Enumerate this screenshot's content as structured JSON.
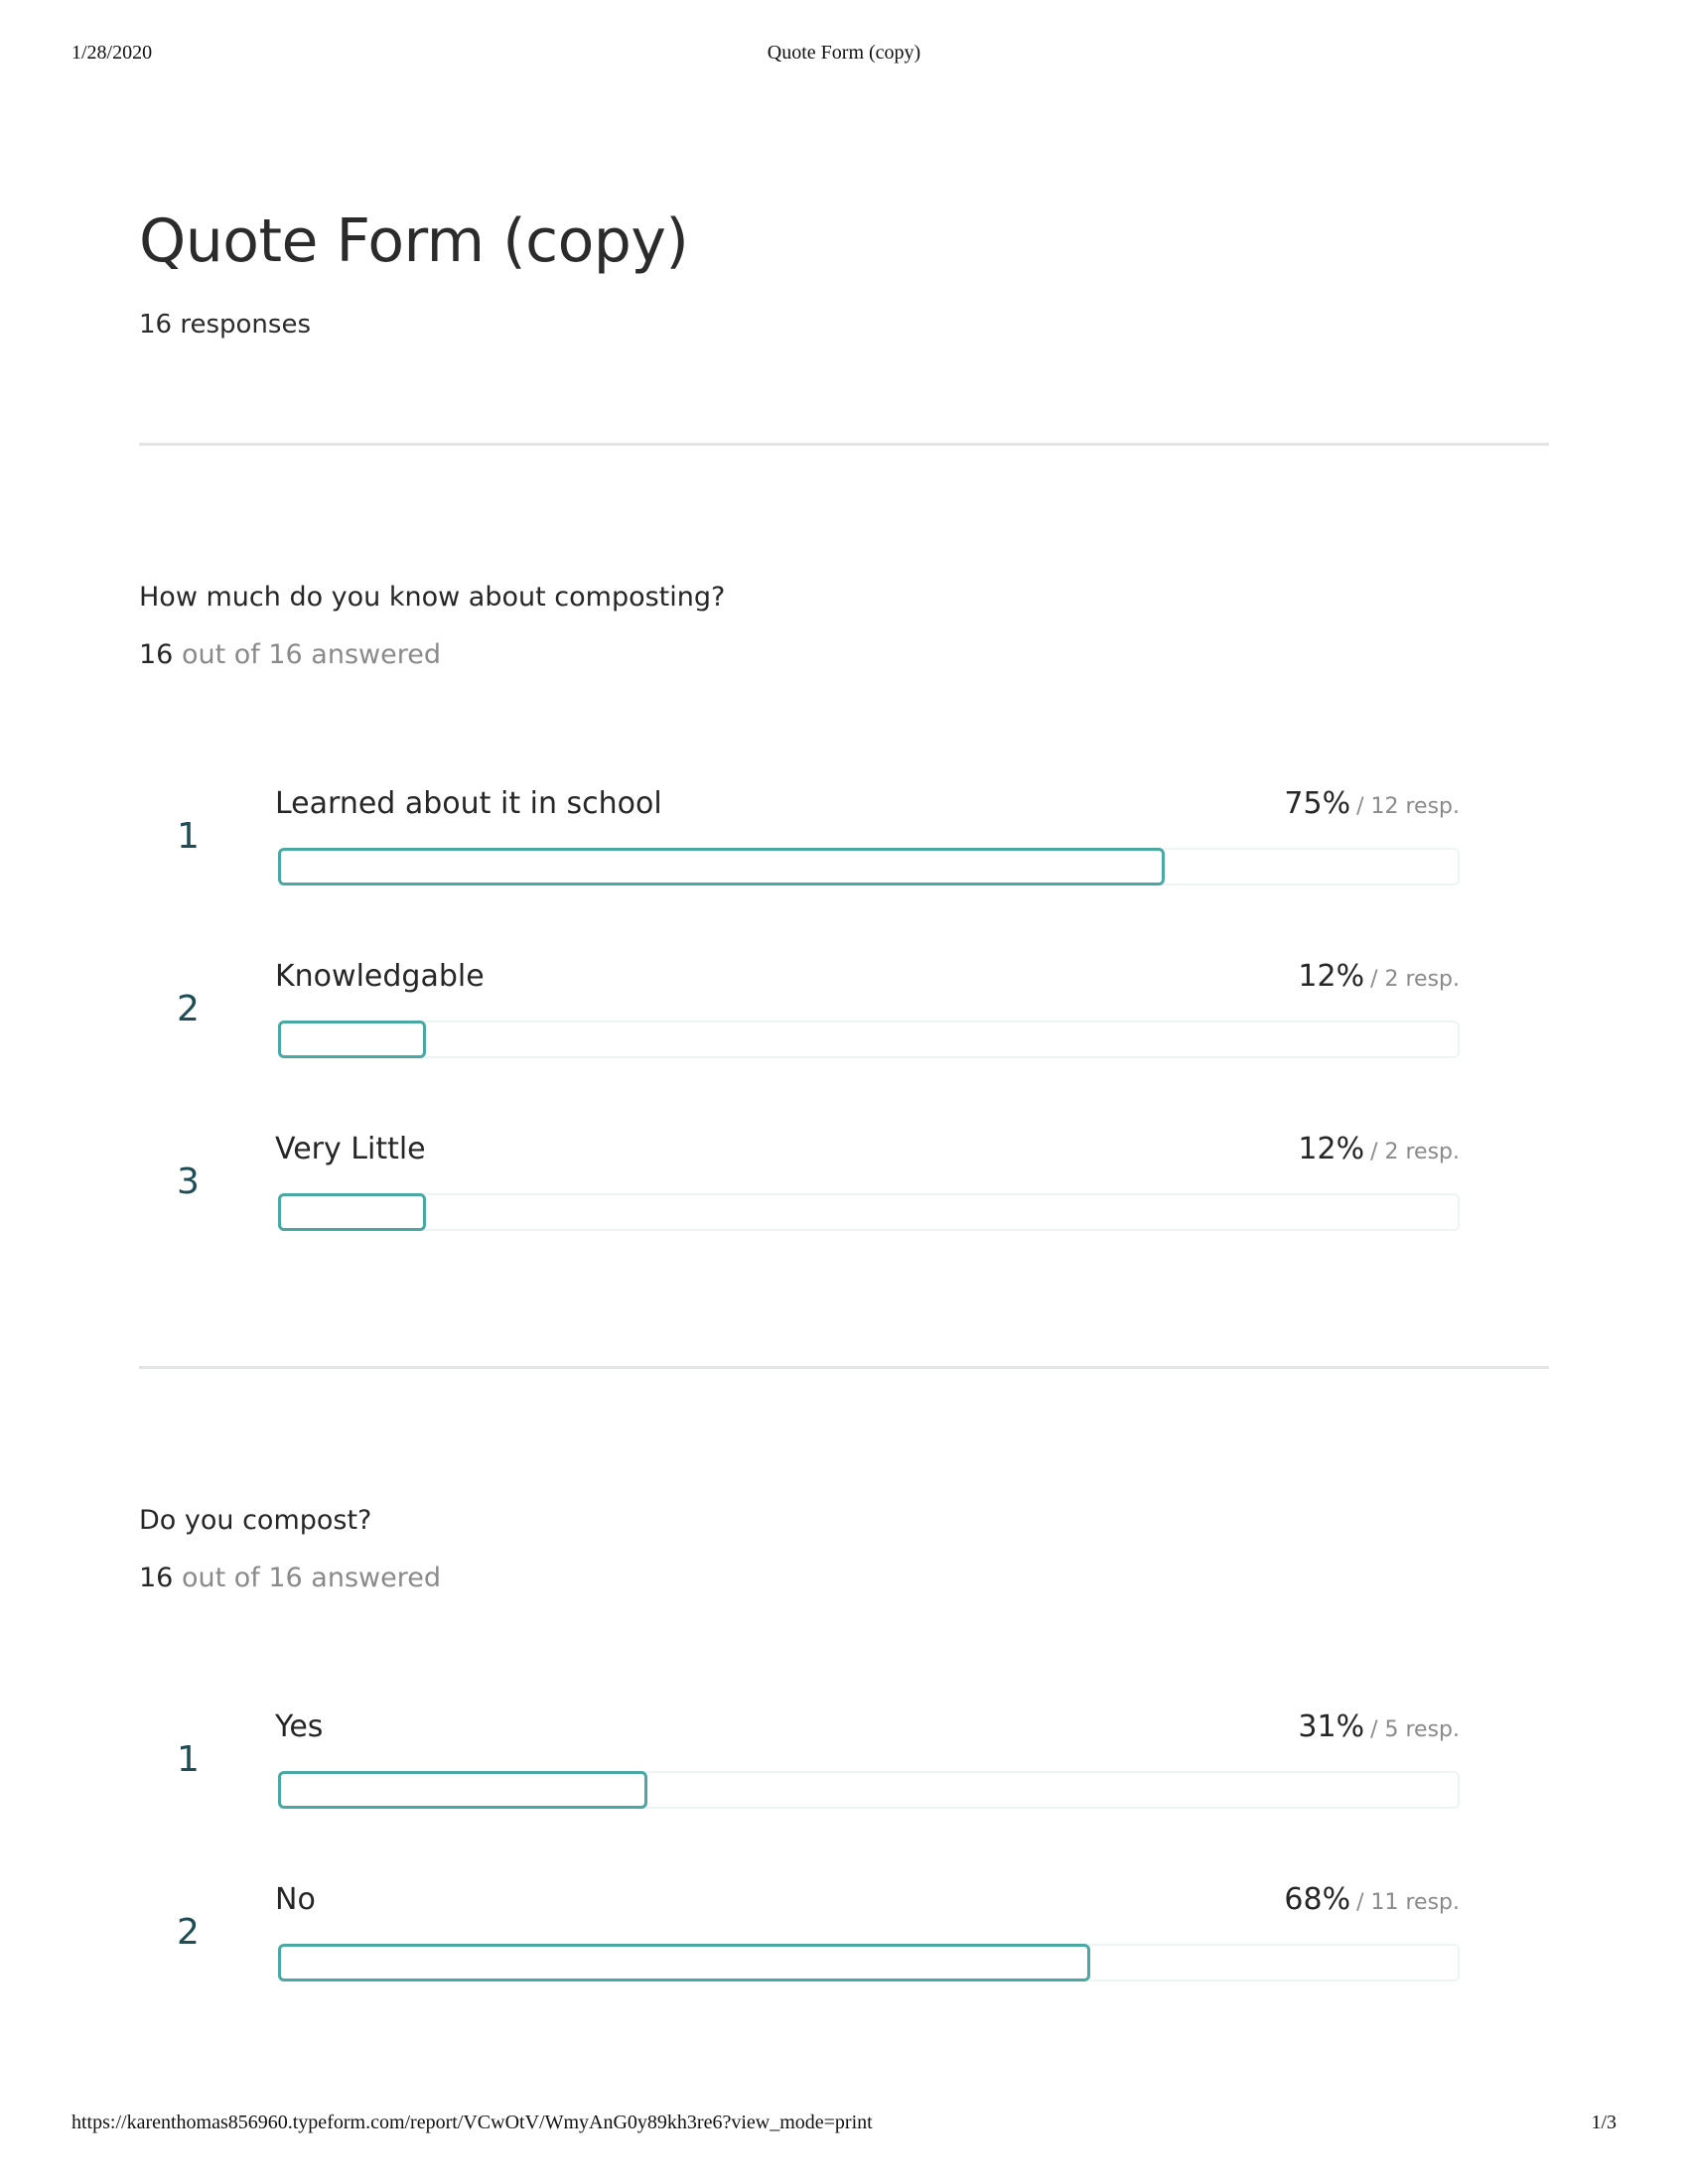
{
  "print_header": {
    "date": "1/28/2020",
    "title": "Quote Form (copy)"
  },
  "print_footer": {
    "url": "https://karenthomas856960.typeform.com/report/VCwOtV/WmyAnG0y89kh3re6?view_mode=print",
    "page": "1/3"
  },
  "report": {
    "title": "Quote Form (copy)",
    "responses": "16 responses"
  },
  "questions": [
    {
      "text": "How much do you know about composting?",
      "answered_count": "16",
      "answered_rest": " out of 16 answered",
      "options": [
        {
          "index": "1",
          "label": "Learned about it in school",
          "percent_label": "75%",
          "resp_label": "/ 12 resp.",
          "fraction": 0.75
        },
        {
          "index": "2",
          "label": "Knowledgable",
          "percent_label": "12%",
          "resp_label": "/ 2 resp.",
          "fraction": 0.125
        },
        {
          "index": "3",
          "label": "Very Little",
          "percent_label": "12%",
          "resp_label": "/ 2 resp.",
          "fraction": 0.125
        }
      ]
    },
    {
      "text": "Do you compost?",
      "answered_count": "16",
      "answered_rest": " out of 16 answered",
      "options": [
        {
          "index": "1",
          "label": "Yes",
          "percent_label": "31%",
          "resp_label": "/ 5 resp.",
          "fraction": 0.3125
        },
        {
          "index": "2",
          "label": "No",
          "percent_label": "68%",
          "resp_label": "/ 11 resp.",
          "fraction": 0.6875
        }
      ]
    }
  ]
}
